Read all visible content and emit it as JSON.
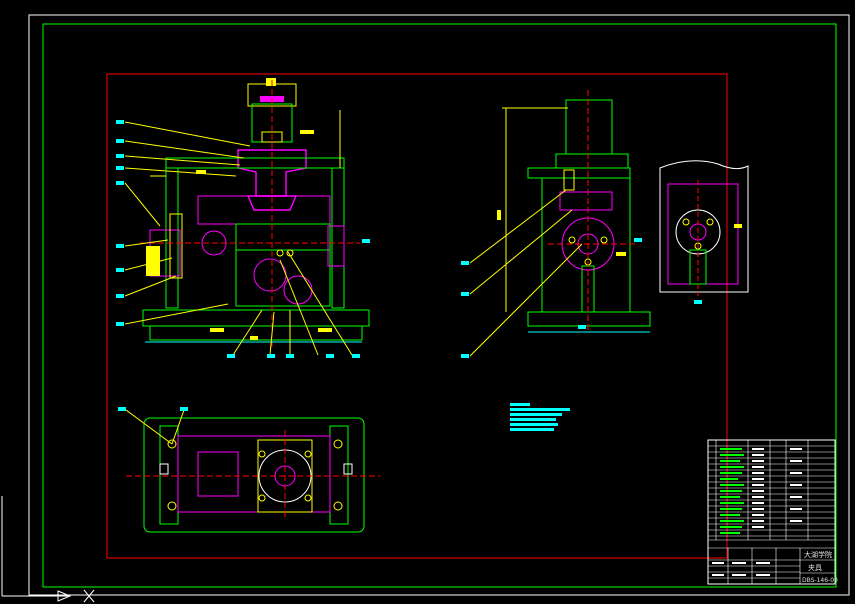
{
  "drawing": {
    "background": "#000000",
    "colors": {
      "frame_outer": "#ffffff",
      "frame_border": "#00ff00",
      "frame_inner": "#ff0000",
      "part_green": "#00ff00",
      "part_magenta": "#ff00ff",
      "leader_yellow": "#ffff00",
      "dim_cyan": "#00ffff",
      "centerline_red": "#ff0000",
      "outline_white": "#ffffff"
    },
    "notes_label": "technical-notes-block"
  },
  "title_block": {
    "company": "大湖学院",
    "part_name": "夹具",
    "drawing_number": "DBS-146-00"
  },
  "icons": {
    "ucs": "ucs-axis-icon"
  }
}
